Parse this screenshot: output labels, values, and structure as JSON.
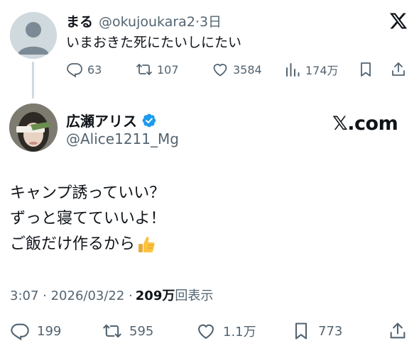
{
  "reply": {
    "name": "まる",
    "handle": "@okujoukara2",
    "dot": "·",
    "time": "3日",
    "text": "いまおきた死にたいしにたい",
    "actions": {
      "replies": "63",
      "reposts": "107",
      "likes": "3584",
      "views": "174万"
    }
  },
  "main": {
    "name": "広瀬アリス",
    "handle": "@Alice1211_Mg",
    "watermark": "𝕏.com",
    "lines": [
      "キャンプ誘っていい？",
      "ずっと寝てていいよ！",
      "ご飯だけ作るから"
    ],
    "emoji": "thumbs-up",
    "meta_time": "3:07 · 2026/03/22 · ",
    "views_count": "209万",
    "views_label": "回表示",
    "actions": {
      "replies": "199",
      "reposts": "595",
      "likes": "1.1万",
      "bookmarks": "773"
    }
  },
  "colors": {
    "text": "#0f1419",
    "secondary": "#536471",
    "verified": "#1d9bf0",
    "avatar_placeholder": "#cfd9de"
  },
  "icons": [
    "default-avatar-icon",
    "x-logo-icon",
    "reply-icon",
    "repost-icon",
    "like-icon",
    "views-icon",
    "bookmark-icon",
    "share-icon",
    "verified-badge-icon",
    "thumbs-up-emoji"
  ]
}
